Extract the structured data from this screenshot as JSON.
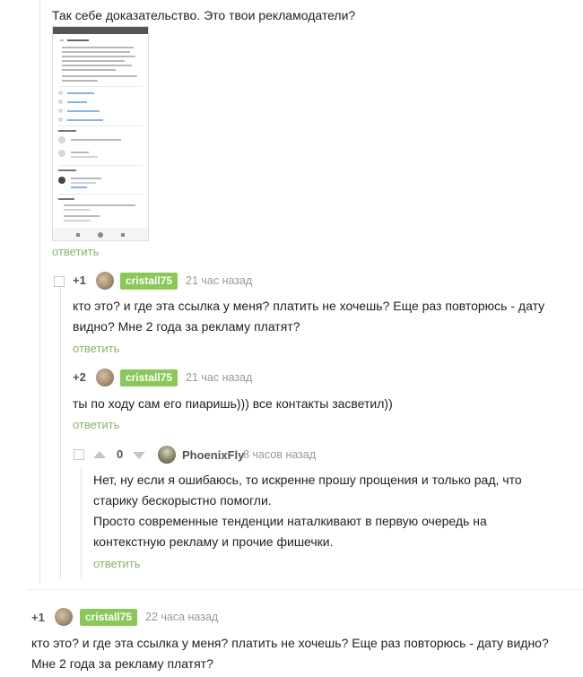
{
  "comment_top": {
    "text": "Так себе доказательство. Это твои рекламодатели?",
    "reply": "ответить"
  },
  "c1": {
    "score": "+1",
    "author": "cristall75",
    "time": "21 час назад",
    "text": "кто это? и где эта ссылка у меня? платить не хочешь? Еще раз повторюсь - дату видно? Мне 2 года за рекламу платят?",
    "reply": "ответить"
  },
  "c2": {
    "score": "+2",
    "author": "cristall75",
    "time": "21 час назад",
    "text": "ты по ходу сам его пиаришь))) все контакты засветил))",
    "reply": "ответить"
  },
  "c3": {
    "score": "0",
    "author": "PhoenixFly",
    "time": "8 часов назад",
    "p1": "Нет, ну если я ошибаюсь, то искренне прошу прощения и только рад, что старику бескорыстно помогли.",
    "p2": "Просто современные тенденции наталкивают в первую очередь на контекстную рекламу и прочие фишечки.",
    "reply": "ответить"
  },
  "c4": {
    "score": "+1",
    "author": "cristall75",
    "time": "22 часа назад",
    "text": "кто это? и где эта ссылка у меня? платить не хочешь? Еще раз повторюсь - дату видно? Мне 2 года за рекламу платят?"
  },
  "colors": {
    "badge": "#8ac858",
    "reply_link": "#8ab36a",
    "thread_line": "#e2e2e2"
  }
}
